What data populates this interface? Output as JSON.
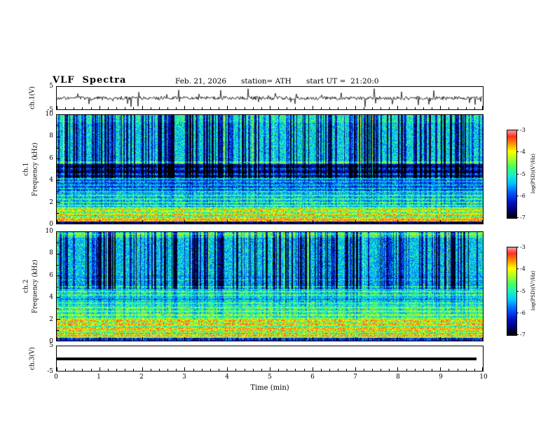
{
  "page": {
    "background": "#ffffff",
    "frame_color": "#000000"
  },
  "header": {
    "title": "VLF  Spectra",
    "date": "Feb. 21, 2026",
    "station": "station= ATH",
    "start_ut": "start UT =  21:20:0"
  },
  "xaxis": {
    "label": "Time  (min)",
    "range": [
      0,
      10
    ],
    "ticks": [
      0,
      1,
      2,
      3,
      4,
      5,
      6,
      7,
      8,
      9,
      10
    ],
    "minor_step": 0.2
  },
  "colormap": {
    "stops": [
      [
        0.0,
        "#000000"
      ],
      [
        0.08,
        "#000066"
      ],
      [
        0.18,
        "#0010c8"
      ],
      [
        0.3,
        "#0060ff"
      ],
      [
        0.4,
        "#00c8ff"
      ],
      [
        0.5,
        "#20f0c0"
      ],
      [
        0.58,
        "#40ff60"
      ],
      [
        0.68,
        "#b0ff20"
      ],
      [
        0.76,
        "#ffff00"
      ],
      [
        0.85,
        "#ff9000"
      ],
      [
        0.93,
        "#ff3020"
      ],
      [
        1.0,
        "#ff9898"
      ]
    ]
  },
  "chart_data": [
    {
      "id": "ch1_waveform",
      "type": "line",
      "ylabel": "ch.1(V)",
      "ylim": [
        -5,
        5
      ],
      "yticks": [
        5,
        -5
      ],
      "description": "Broadband VLF time-series: noise around 0 V with frequent impulsive sferic spikes reaching about ±5 V across the full 0–10 min record",
      "seed": 9,
      "noise_amp": 0.8,
      "spike_prob": 0.05,
      "spike_amp": 3.6
    },
    {
      "id": "ch1_spectrogram",
      "type": "heatmap",
      "ylabel_line1": "ch.1",
      "ylabel_line2": "Frequency (kHz)",
      "ylim": [
        0,
        10
      ],
      "yticks": [
        0,
        2,
        4,
        6,
        8,
        10
      ],
      "xlim": [
        0,
        10
      ],
      "colorbar": {
        "label": "log(PSD)(V²/Hz)",
        "ticks": [
          -3,
          -4,
          -5,
          -6,
          -7
        ],
        "range_top_to_bottom": [
          -3,
          -7
        ]
      },
      "description": "0–10 kHz spectrogram: green/cyan speckle above ~5.5 kHz cut by dense dark-blue vertical sferic streaks; dark blue band 4.3–5.5 kHz with horizontal tone lines; green/yellow horizontal power-line bands below 2 kHz; red/dark band at 0–0.5 kHz",
      "seed": 42,
      "noise": 0.15,
      "speck_prob": 0.004,
      "speck_amp": 0.35,
      "profile": [
        [
          9.3,
          10.01,
          0.5
        ],
        [
          5.5,
          9.3,
          0.44
        ],
        [
          4.3,
          5.5,
          0.17
        ],
        [
          3.0,
          4.3,
          0.3
        ],
        [
          1.5,
          3.0,
          0.42
        ],
        [
          0.55,
          1.5,
          0.55
        ],
        [
          0.2,
          0.55,
          0.75
        ],
        [
          0,
          0.2,
          0.12
        ]
      ],
      "lines": [
        [
          5.65,
          0.22
        ],
        [
          5.3,
          -0.1
        ],
        [
          5.05,
          0.15
        ],
        [
          4.8,
          -0.12
        ],
        [
          4.55,
          0.18
        ],
        [
          4.35,
          -0.1
        ],
        [
          4.15,
          0.2
        ],
        [
          3.85,
          0.15
        ],
        [
          3.55,
          0.18
        ],
        [
          3.25,
          0.2
        ],
        [
          2.95,
          0.18
        ],
        [
          2.6,
          0.2
        ],
        [
          2.25,
          0.22
        ],
        [
          1.95,
          0.2
        ],
        [
          1.7,
          0.22
        ],
        [
          1.45,
          0.25
        ],
        [
          1.15,
          0.28,
          0.12
        ],
        [
          0.85,
          0.3,
          0.1
        ],
        [
          0.6,
          0.25
        ],
        [
          0.35,
          0.25
        ]
      ],
      "streaks": {
        "dark_prob": 0.3,
        "dark_amp": 0.34,
        "bright_prob": 0.06,
        "bright_amp": 0.18,
        "full_fmin": 4.2,
        "partial_factor": 0.25
      }
    },
    {
      "id": "ch2_spectrogram",
      "type": "heatmap",
      "ylabel_line1": "ch.2",
      "ylabel_line2": "Frequency (kHz)",
      "ylim": [
        0,
        10
      ],
      "yticks": [
        0,
        2,
        4,
        6,
        8,
        10
      ],
      "xlim": [
        0,
        10
      ],
      "colorbar": {
        "label": "log(PSD)(V²/Hz)",
        "ticks": [
          -3,
          -4,
          -5,
          -6,
          -7
        ],
        "range_top_to_bottom": [
          -3,
          -7
        ]
      },
      "description": "0–10 kHz spectrogram: dark-blue sferic streaks over green speckle above ~5 kHz; strong yellow/green/orange horizontal harmonic bands between 0.3 and 3.3 kHz; red/dark band near 0 kHz",
      "seed": 77,
      "noise": 0.15,
      "speck_prob": 0.006,
      "speck_amp": 0.35,
      "profile": [
        [
          9.5,
          10.01,
          0.55
        ],
        [
          6.0,
          9.5,
          0.42
        ],
        [
          4.8,
          6.0,
          0.38
        ],
        [
          3.3,
          4.8,
          0.46
        ],
        [
          2.0,
          3.3,
          0.52
        ],
        [
          0.8,
          2.0,
          0.6
        ],
        [
          0.25,
          0.8,
          0.68
        ],
        [
          0,
          0.25,
          0.25
        ]
      ],
      "lines": [
        [
          9.8,
          0.15
        ],
        [
          5.6,
          0.12
        ],
        [
          4.95,
          0.22
        ],
        [
          4.5,
          0.2
        ],
        [
          4.2,
          0.18
        ],
        [
          3.8,
          -0.1
        ],
        [
          3.45,
          0.15
        ],
        [
          3.05,
          0.25
        ],
        [
          2.7,
          0.2
        ],
        [
          2.35,
          0.25
        ],
        [
          2.05,
          0.2
        ],
        [
          1.8,
          0.3,
          0.12
        ],
        [
          1.5,
          0.28,
          0.14
        ],
        [
          1.15,
          0.32,
          0.1
        ],
        [
          0.9,
          0.28
        ],
        [
          0.65,
          0.3
        ],
        [
          0.45,
          0.28
        ]
      ],
      "streaks": {
        "dark_prob": 0.3,
        "dark_amp": 0.32,
        "bright_prob": 0.05,
        "bright_amp": 0.15,
        "full_fmin": 4.8,
        "partial_factor": 0.3
      }
    },
    {
      "id": "ch3_waveform",
      "type": "line",
      "ylabel": "ch.3(V)",
      "ylim": [
        -5,
        5
      ],
      "yticks": [
        5,
        -5
      ],
      "description": "Channel 3 is flat: a thick constant line at 0 V from 0 to about 9.85 min",
      "value": 0,
      "x_extent": [
        0,
        9.85
      ]
    }
  ]
}
